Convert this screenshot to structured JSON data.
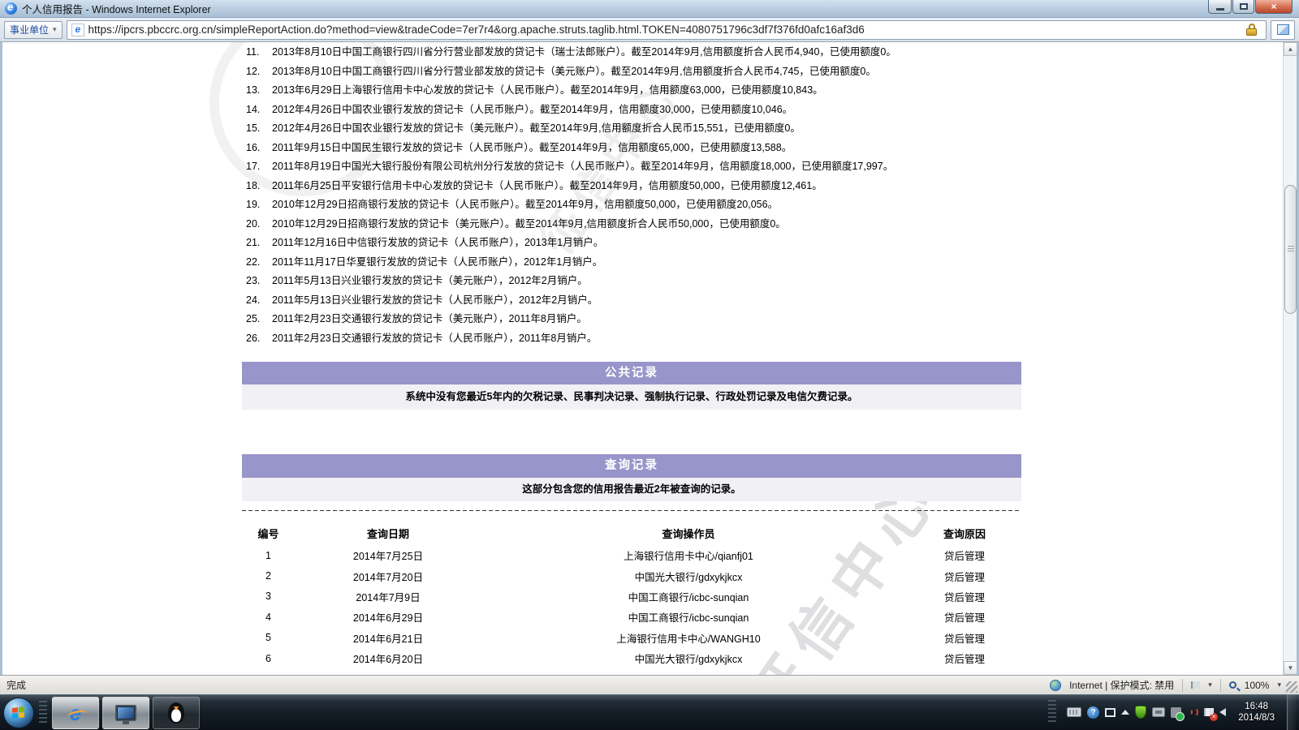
{
  "window": {
    "title": "个人信用报告 - Windows Internet Explorer",
    "zone_button": "事业单位",
    "url": "https://ipcrs.pbccrc.org.cn/simpleReportAction.do?method=view&tradeCode=7er7r4&org.apache.struts.taglib.html.TOKEN=4080751796c3df7f376fd0afc16af3d6"
  },
  "colors": {
    "section_header_bg": "#9795c9",
    "section_body_bg": "#f1f0f5",
    "close_button_red": "#b8452b"
  },
  "credit_cards": [
    {
      "num": "11.",
      "text": "2013年8月10日中国工商银行四川省分行营业部发放的贷记卡（瑞士法郎账户）。截至2014年9月,信用额度折合人民币4,940，已使用额度0。"
    },
    {
      "num": "12.",
      "text": "2013年8月10日中国工商银行四川省分行营业部发放的贷记卡（美元账户）。截至2014年9月,信用额度折合人民币4,745，已使用额度0。"
    },
    {
      "num": "13.",
      "text": "2013年6月29日上海银行信用卡中心发放的贷记卡（人民币账户）。截至2014年9月，信用额度63,000，已使用额度10,843。"
    },
    {
      "num": "14.",
      "text": "2012年4月26日中国农业银行发放的贷记卡（人民币账户）。截至2014年9月，信用额度30,000，已使用额度10,046。"
    },
    {
      "num": "15.",
      "text": "2012年4月26日中国农业银行发放的贷记卡（美元账户）。截至2014年9月,信用额度折合人民币15,551，已使用额度0。"
    },
    {
      "num": "16.",
      "text": "2011年9月15日中国民生银行发放的贷记卡（人民币账户）。截至2014年9月，信用额度65,000，已使用额度13,588。"
    },
    {
      "num": "17.",
      "text": "2011年8月19日中国光大银行股份有限公司杭州分行发放的贷记卡（人民币账户）。截至2014年9月，信用额度18,000，已使用额度17,997。"
    },
    {
      "num": "18.",
      "text": "2011年6月25日平安银行信用卡中心发放的贷记卡（人民币账户）。截至2014年9月，信用额度50,000，已使用额度12,461。"
    },
    {
      "num": "19.",
      "text": "2010年12月29日招商银行发放的贷记卡（人民币账户）。截至2014年9月，信用额度50,000，已使用额度20,056。"
    },
    {
      "num": "20.",
      "text": "2010年12月29日招商银行发放的贷记卡（美元账户）。截至2014年9月,信用额度折合人民币50,000，已使用额度0。"
    },
    {
      "num": "21.",
      "text": "2011年12月16日中信银行发放的贷记卡（人民币账户），2013年1月销户。"
    },
    {
      "num": "22.",
      "text": "2011年11月17日华夏银行发放的贷记卡（人民币账户），2012年1月销户。"
    },
    {
      "num": "23.",
      "text": "2011年5月13日兴业银行发放的贷记卡（美元账户），2012年2月销户。"
    },
    {
      "num": "24.",
      "text": "2011年5月13日兴业银行发放的贷记卡（人民币账户），2012年2月销户。"
    },
    {
      "num": "25.",
      "text": "2011年2月23日交通银行发放的贷记卡（美元账户），2011年8月销户。"
    },
    {
      "num": "26.",
      "text": "2011年2月23日交通银行发放的贷记卡（人民币账户），2011年8月销户。"
    }
  ],
  "public_records": {
    "title": "公共记录",
    "body": "系统中没有您最近5年内的欠税记录、民事判决记录、强制执行记录、行政处罚记录及电信欠费记录。"
  },
  "query_records": {
    "title": "查询记录",
    "intro": "这部分包含您的信用报告最近2年被查询的记录。",
    "columns": [
      "编号",
      "查询日期",
      "查询操作员",
      "查询原因"
    ],
    "rows": [
      [
        "1",
        "2014年7月25日",
        "上海银行信用卡中心/qianfj01",
        "贷后管理"
      ],
      [
        "2",
        "2014年7月20日",
        "中国光大银行/gdxykjkcx",
        "贷后管理"
      ],
      [
        "3",
        "2014年7月9日",
        "中国工商银行/icbc-sunqian",
        "贷后管理"
      ],
      [
        "4",
        "2014年6月29日",
        "中国工商银行/icbc-sunqian",
        "贷后管理"
      ],
      [
        "5",
        "2014年6月21日",
        "上海银行信用卡中心/WANGH10",
        "贷后管理"
      ],
      [
        "6",
        "2014年6月20日",
        "中国光大银行/gdxykjkcx",
        "贷后管理"
      ]
    ]
  },
  "watermark": "征信中心",
  "status_bar": {
    "done": "完成",
    "zone": "Internet | 保护模式: 禁用",
    "zoom_level": "100%"
  },
  "taskbar": {
    "time": "16:48",
    "date": "2014/8/3"
  }
}
